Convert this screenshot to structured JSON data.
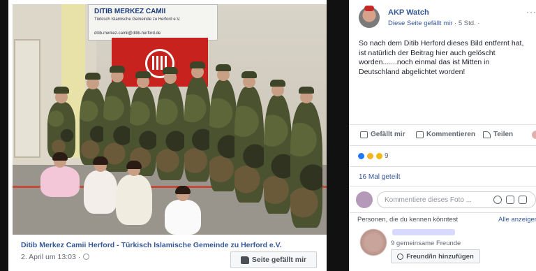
{
  "left_post": {
    "sign": {
      "title": "DITIB MERKEZ CAMII",
      "subtitle": "Türkisch Islamische Gemeinde zu Herford e.V.",
      "email": "ditib-merkez-camii@ditib-herford.de"
    },
    "caption_title": "Ditib Merkez Camii Herford - Türkisch Islamische Gemeinde zu Herford e.V.",
    "caption_date": "2. April um 13:03 ·",
    "like_page_label": "Seite gefällt mir",
    "icons": [
      "globe-icon",
      "thumbs-up-icon"
    ]
  },
  "right_post": {
    "page_name": "AKP Watch",
    "meta_liked": "Diese Seite gefällt mir",
    "meta_time": " · 5 Std. ·",
    "more": "···",
    "text": "So nach dem Ditib Herford dieses Bild entfernt hat, ist natürlich der Beitrag hier auch gelöscht worden.......noch einmal das ist Mitten in Deutschland abgelichtet worden!",
    "actions": {
      "like": "Gefällt mir",
      "comment": "Kommentieren",
      "share": "Teilen"
    },
    "reaction_count": "9",
    "shares": "16 Mal geteilt",
    "comment_placeholder": "Kommentiere dieses Foto ...",
    "pymk": {
      "title": "Personen, die du kennen könntest",
      "see_all": "Alle anzeigen",
      "mutual": "9 gemeinsame Freunde",
      "add_friend": "Freund/in hinzufügen"
    },
    "colors": {
      "link": "#365899",
      "like_reaction": "#2078f4",
      "haha_reaction": "#f7b125"
    }
  }
}
